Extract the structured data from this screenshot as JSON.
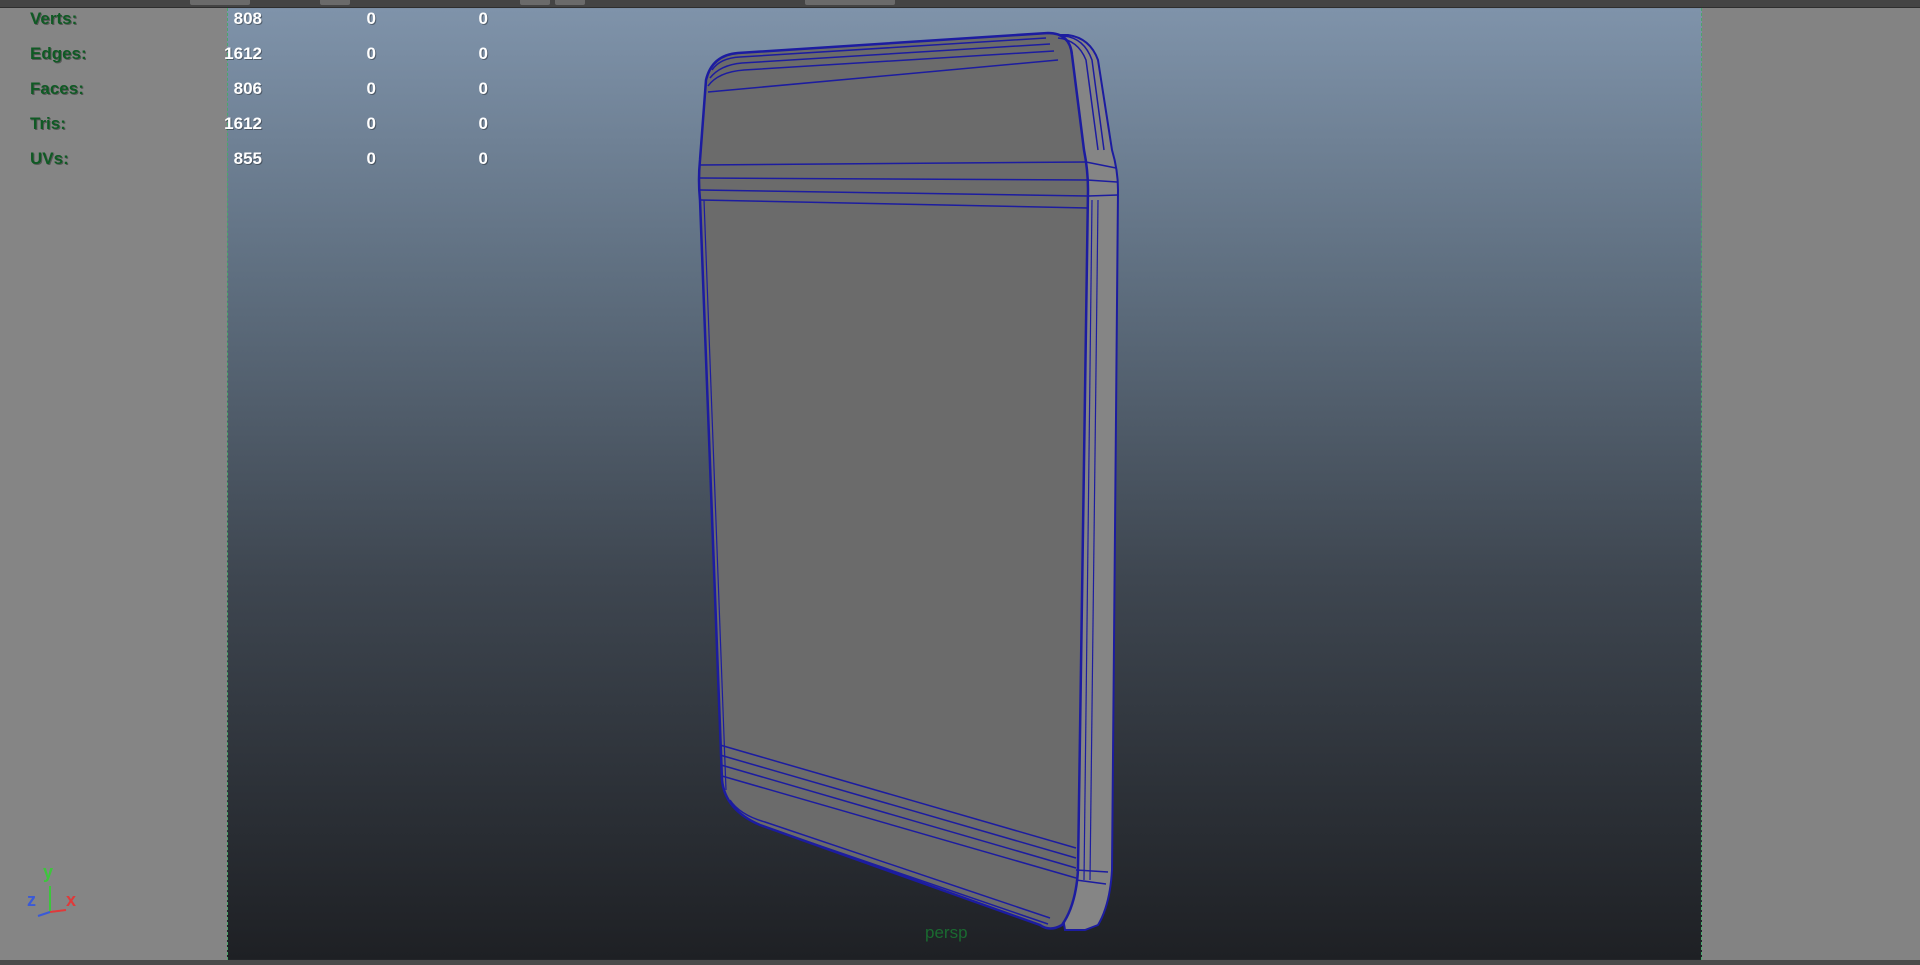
{
  "hud": {
    "rows": [
      {
        "label": "Verts:",
        "v1": "808",
        "v2": "0",
        "v3": "0"
      },
      {
        "label": "Edges:",
        "v1": "1612",
        "v2": "0",
        "v3": "0"
      },
      {
        "label": "Faces:",
        "v1": "806",
        "v2": "0",
        "v3": "0"
      },
      {
        "label": "Tris:",
        "v1": "1612",
        "v2": "0",
        "v3": "0"
      },
      {
        "label": "UVs:",
        "v1": "855",
        "v2": "0",
        "v3": "0"
      }
    ]
  },
  "axis": {
    "y": "y",
    "z": "z",
    "x": "x"
  },
  "camera": {
    "name": "persp"
  },
  "colors": {
    "hud_label": "#0f5a24",
    "hud_value": "#ffffff",
    "wireframe": "#1c1ca0",
    "mesh_face": "#6b6b6b",
    "viewport_border": "#49a86a"
  }
}
